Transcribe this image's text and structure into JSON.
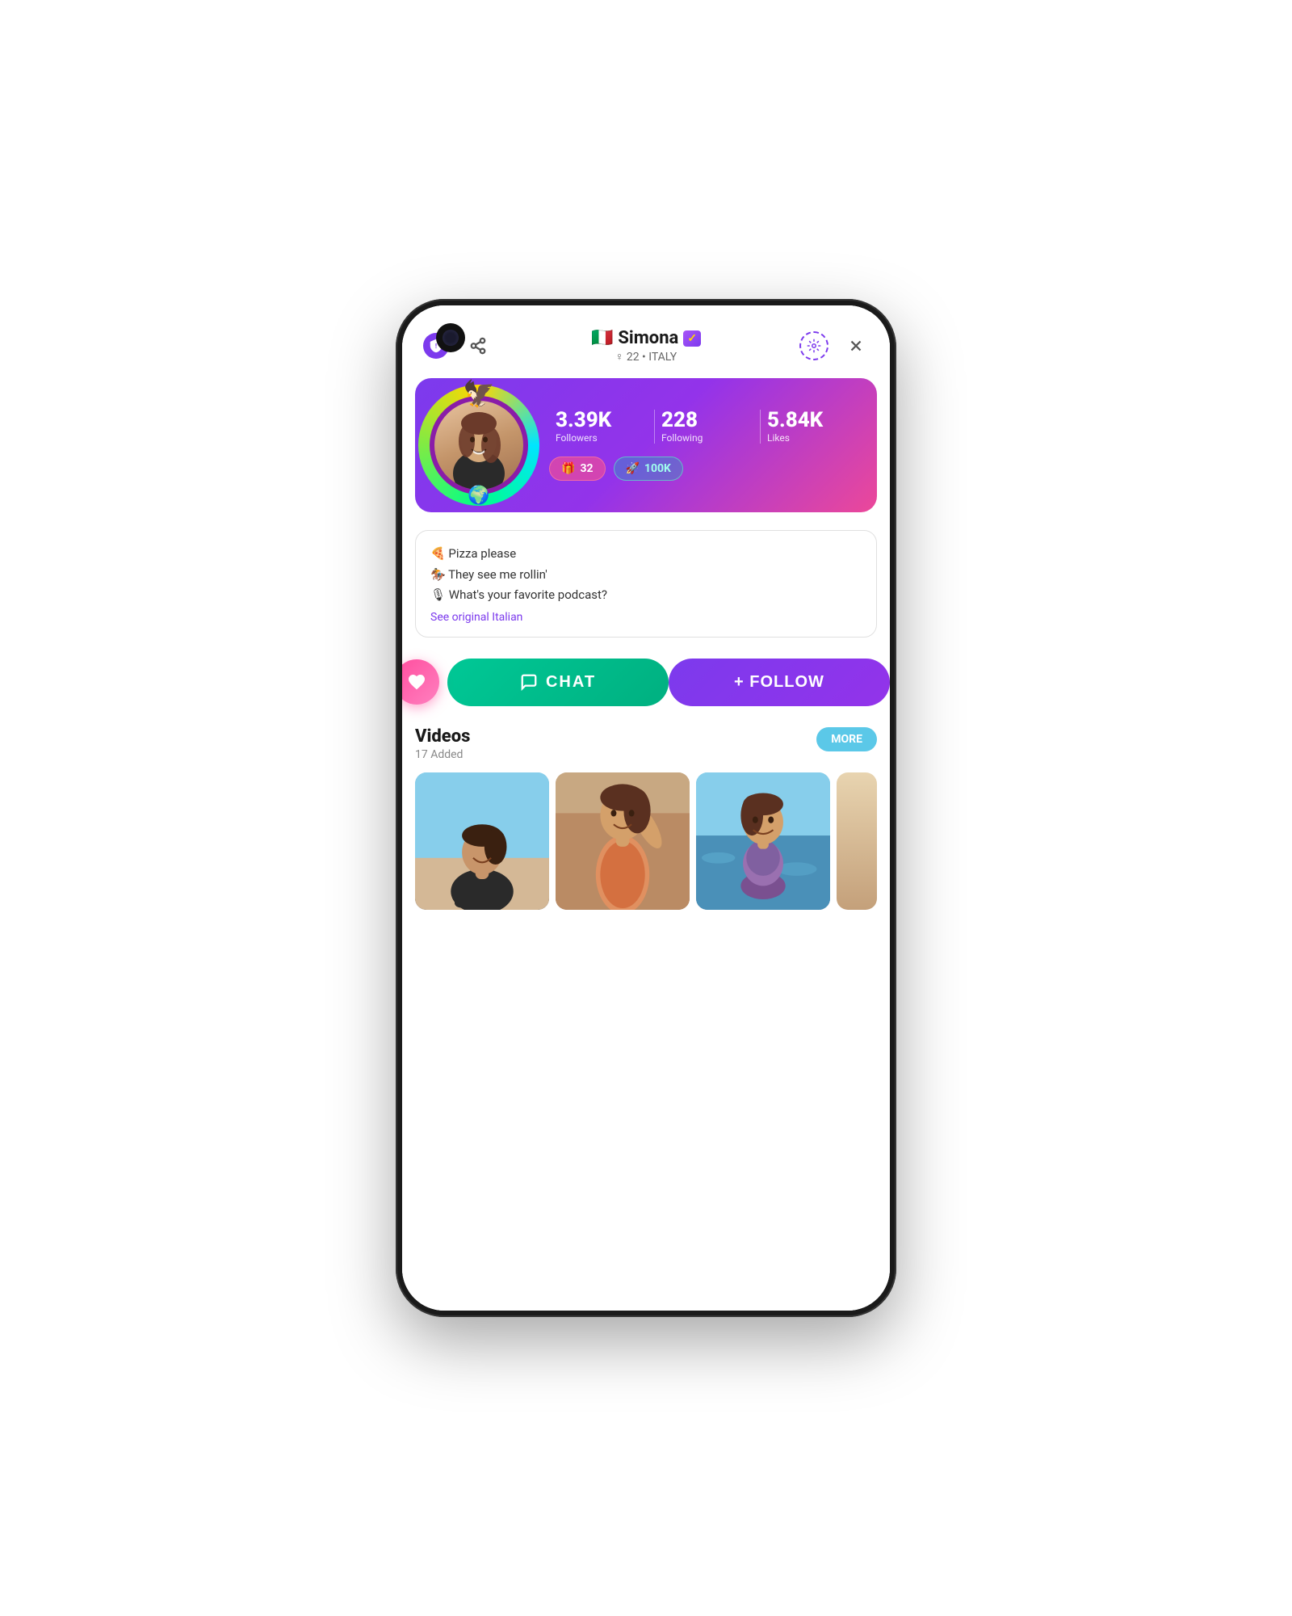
{
  "phone": {
    "background": "#ffffff"
  },
  "header": {
    "name": "Simona",
    "flag": "🇮🇹",
    "verified": true,
    "gender": "♀",
    "age": "22",
    "country": "ITALY",
    "subtitle": "♀ 22 • ITALY"
  },
  "stats": {
    "followers_value": "3.39K",
    "followers_label": "Followers",
    "following_value": "228",
    "following_label": "Following",
    "likes_value": "5.84K",
    "likes_label": "Likes",
    "gifts_count": "32",
    "score": "100K"
  },
  "bio": {
    "line1": "🍕 Pizza please",
    "line2": "🏇 They see me rollin'",
    "line3": "🎙 What's your favorite podcast?",
    "link": "See original Italian"
  },
  "actions": {
    "chat_label": "CHAT",
    "follow_label": "+ FOLLOW"
  },
  "videos": {
    "title": "Videos",
    "subtitle": "17 Added",
    "more_btn": "MORE"
  },
  "icons": {
    "shield": "🛡",
    "share": "⤴",
    "close": "✕",
    "settings": "⚙",
    "heart": "♥",
    "chat_bubble": "○",
    "plus": "+",
    "gift": "🎁",
    "rocket": "🚀"
  }
}
